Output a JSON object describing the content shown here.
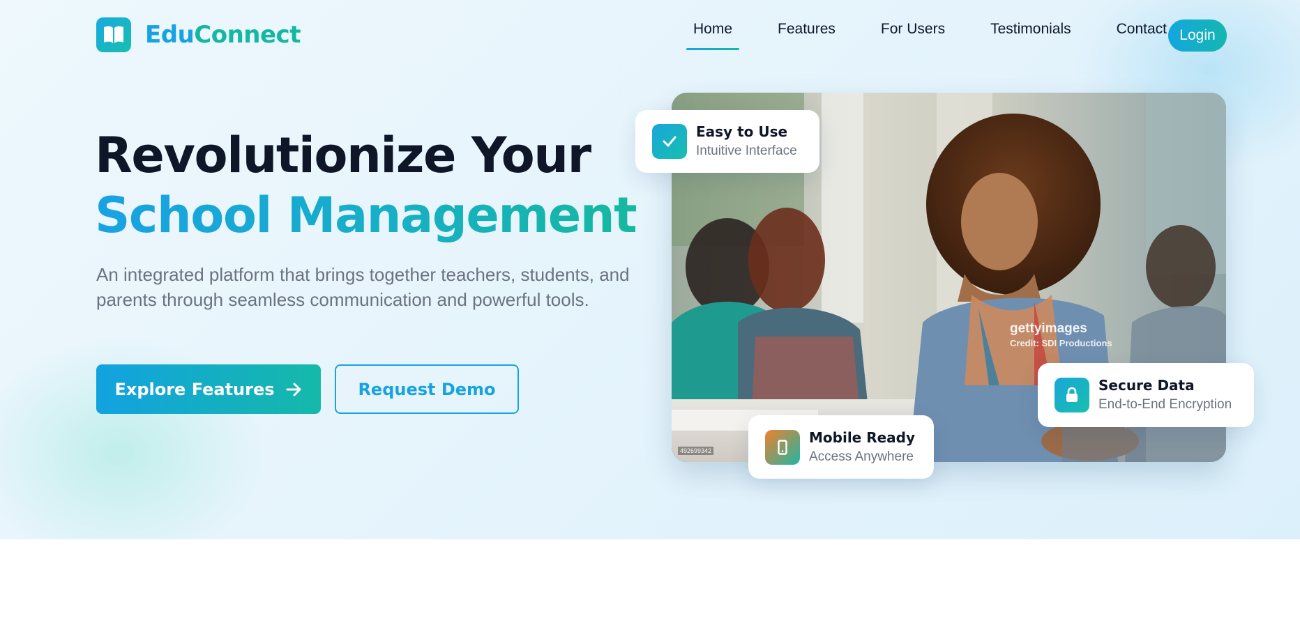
{
  "brand": {
    "part1": "Edu",
    "part2": "Connect",
    "icon": "book-icon"
  },
  "nav": {
    "items": [
      {
        "label": "Home",
        "active": true
      },
      {
        "label": "Features",
        "active": false
      },
      {
        "label": "For Users",
        "active": false
      },
      {
        "label": "Testimonials",
        "active": false
      },
      {
        "label": "Contact",
        "active": false
      }
    ],
    "login_label": "Login"
  },
  "hero": {
    "title_line1": "Revolutionize Your",
    "title_line2": "School Management",
    "subtitle": "An integrated platform that brings together teachers, students, and parents through seamless communication and powerful tools.",
    "primary_cta": "Explore Features",
    "secondary_cta": "Request Demo"
  },
  "image": {
    "watermark_brand": "gettyimages",
    "watermark_credit": "Credit: SDI Productions",
    "image_id": "492699342"
  },
  "features": [
    {
      "title": "Easy to Use",
      "subtitle": "Intuitive Interface",
      "icon": "check-icon"
    },
    {
      "title": "Mobile Ready",
      "subtitle": "Access Anywhere",
      "icon": "mobile-icon"
    },
    {
      "title": "Secure Data",
      "subtitle": "End-to-End Encryption",
      "icon": "lock-icon"
    }
  ],
  "colors": {
    "primary": "#17a3e2",
    "secondary": "#16b7a2",
    "heading": "#0e1628",
    "body_text": "#6b7280"
  }
}
